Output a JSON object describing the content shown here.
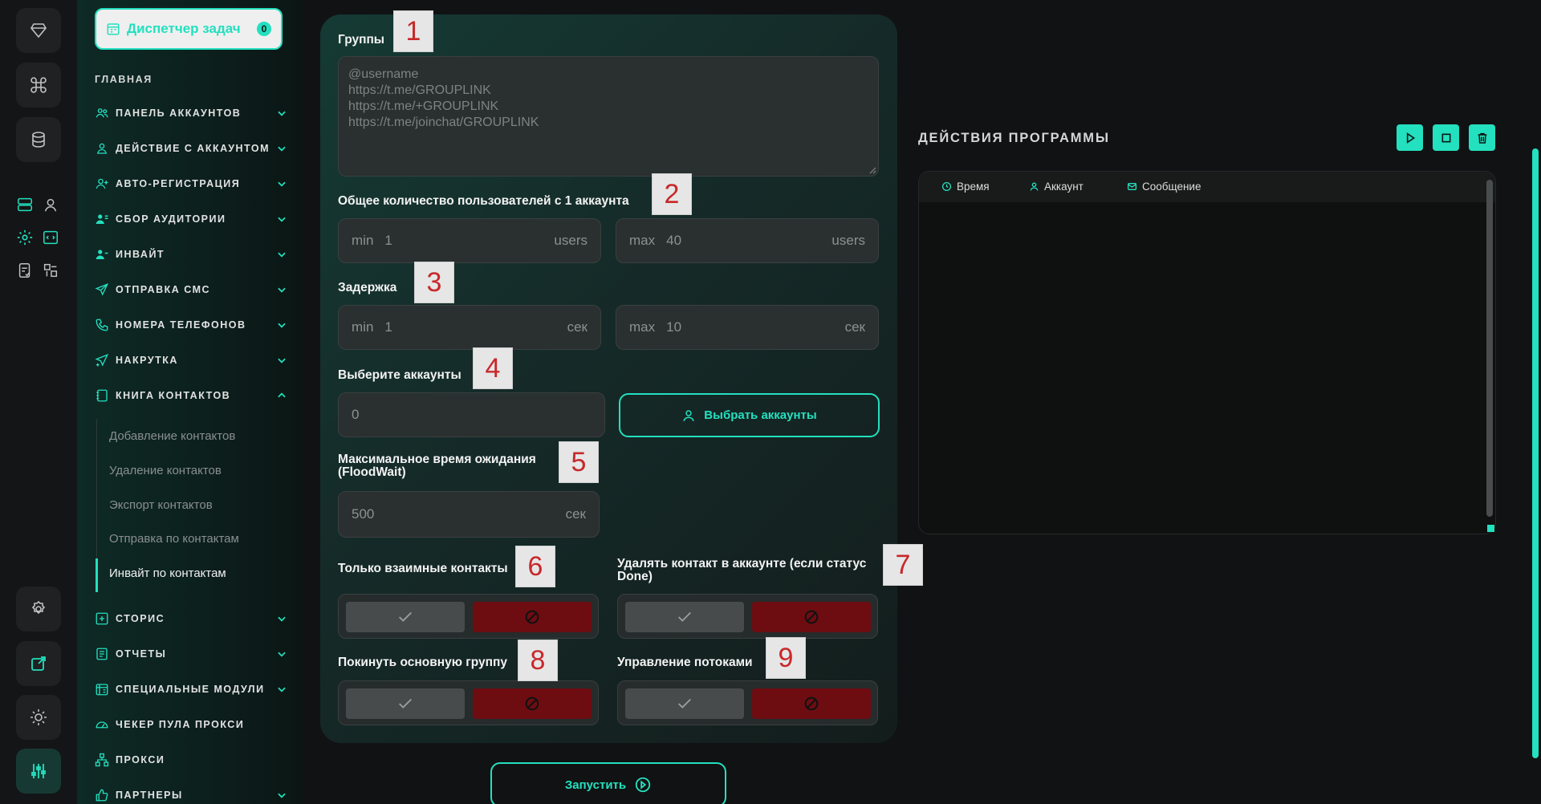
{
  "sidebar": {
    "task_manager": "Диспетчер задач",
    "task_badge": "0",
    "heading": "ГЛАВНАЯ",
    "items": [
      {
        "label": "ПАНЕЛЬ АККАУНТОВ"
      },
      {
        "label": "ДЕЙСТВИЕ С АККАУНТОМ"
      },
      {
        "label": "АВТО-РЕГИСТРАЦИЯ"
      },
      {
        "label": "СБОР АУДИТОРИИ"
      },
      {
        "label": "ИНВАЙТ"
      },
      {
        "label": "ОТПРАВКА СМС"
      },
      {
        "label": "НОМЕРА ТЕЛЕФОНОВ"
      },
      {
        "label": "НАКРУТКА"
      },
      {
        "label": "КНИГА КОНТАКТОВ"
      },
      {
        "label": "СТОРИС"
      },
      {
        "label": "ОТЧЕТЫ"
      },
      {
        "label": "СПЕЦИАЛЬНЫЕ МОДУЛИ"
      },
      {
        "label": "ЧЕКЕР ПУЛА ПРОКСИ"
      },
      {
        "label": "ПРОКСИ"
      },
      {
        "label": "ПАРТНЕРЫ"
      }
    ],
    "subitems": [
      {
        "label": "Добавление контактов"
      },
      {
        "label": "Удаление контактов"
      },
      {
        "label": "Экспорт контактов"
      },
      {
        "label": "Отправка по контактам"
      },
      {
        "label": "Инвайт по контактам"
      }
    ]
  },
  "form": {
    "groups_label": "Группы",
    "groups_placeholder": "@username\nhttps://t.me/GROUPLINK\nhttps://t.me/+GROUPLINK\nhttps://t.me/joinchat/GROUPLINK",
    "users_label": "Общее количество пользователей с 1 аккаунта",
    "users_min_prefix": "min",
    "users_min": "1",
    "users_min_unit": "users",
    "users_max_prefix": "max",
    "users_max": "40",
    "users_max_unit": "users",
    "delay_label": "Задержка",
    "delay_min_prefix": "min",
    "delay_min": "1",
    "delay_min_unit": "сек",
    "delay_max_prefix": "max",
    "delay_max": "10",
    "delay_max_unit": "сек",
    "accounts_label": "Выберите аккаунты",
    "accounts_value": "0",
    "choose_accounts": "Выбрать аккаунты",
    "floodwait_label_1": "Максимальное время ожидания",
    "floodwait_label_2": "(FloodWait)",
    "floodwait_value": "500",
    "floodwait_unit": "сек",
    "mutual_label": "Только взаимные контакты",
    "delete_label_1": "Удалять контакт в аккаунте (если статус",
    "delete_label_2": "Done)",
    "leave_label": "Покинуть основную группу",
    "threads_label": "Управление потоками",
    "run": "Запустить"
  },
  "markers": [
    "1",
    "2",
    "3",
    "4",
    "5",
    "6",
    "7",
    "8",
    "9"
  ],
  "actions": {
    "title": "ДЕЙСТВИЯ ПРОГРАММЫ",
    "col_time": "Время",
    "col_account": "Аккаунт",
    "col_message": "Сообщение"
  },
  "colors": {
    "accent": "#23e0bf",
    "danger": "#6d0d12"
  }
}
